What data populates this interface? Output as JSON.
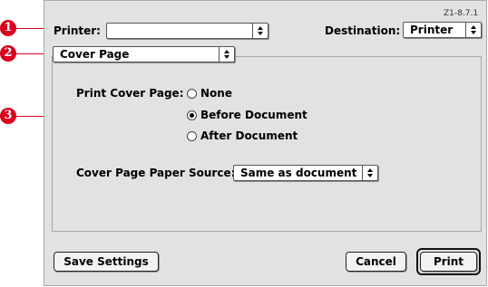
{
  "version_label": "Z1-8.7.1",
  "printer": {
    "label": "Printer:",
    "value": ""
  },
  "destination": {
    "label": "Destination:",
    "value": "Printer"
  },
  "panel_menu": {
    "value": "Cover Page"
  },
  "cover_page": {
    "label": "Print Cover Page:",
    "options": [
      {
        "label": "None",
        "selected": false
      },
      {
        "label": "Before Document",
        "selected": true
      },
      {
        "label": "After Document",
        "selected": false
      }
    ]
  },
  "paper_source": {
    "label": "Cover Page Paper Source:",
    "value": "Same as document"
  },
  "buttons": {
    "save": "Save Settings",
    "cancel": "Cancel",
    "print": "Print"
  },
  "callouts": [
    "1",
    "2",
    "3"
  ],
  "colors": {
    "callout": "#d8001c",
    "dialog_bg": "#e2e2e2"
  }
}
